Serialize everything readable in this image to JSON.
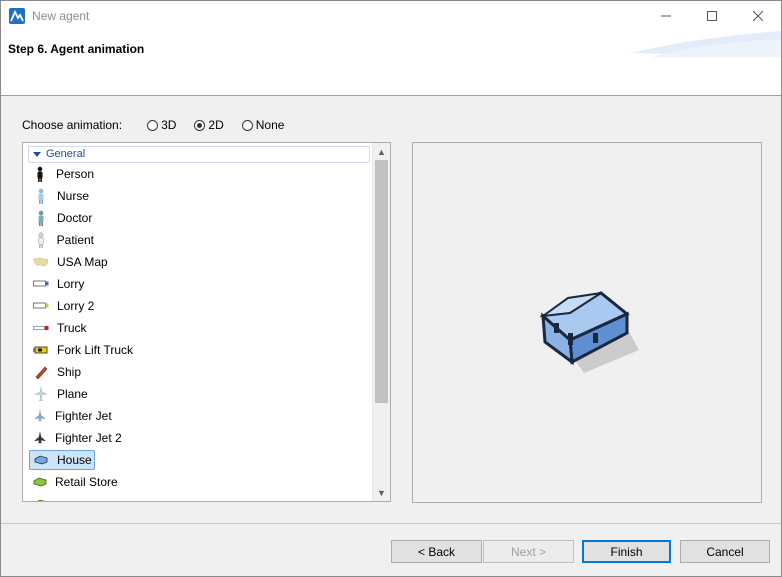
{
  "window": {
    "title": "New agent",
    "controls": {
      "minimize_icon": "minimize-icon",
      "maximize_icon": "maximize-icon",
      "close_icon": "close-icon"
    }
  },
  "header": {
    "title": "Step 6. Agent animation"
  },
  "animation_choice": {
    "label": "Choose animation:",
    "options": [
      {
        "label": "3D",
        "checked": false
      },
      {
        "label": "2D",
        "checked": true
      },
      {
        "label": "None",
        "checked": false
      }
    ]
  },
  "list": {
    "group": "General",
    "items": [
      {
        "label": "Person",
        "icon": "person-icon",
        "selected": false
      },
      {
        "label": "Nurse",
        "icon": "nurse-icon",
        "selected": false
      },
      {
        "label": "Doctor",
        "icon": "doctor-icon",
        "selected": false
      },
      {
        "label": "Patient",
        "icon": "patient-icon",
        "selected": false
      },
      {
        "label": "USA Map",
        "icon": "usa-map-icon",
        "selected": false
      },
      {
        "label": "Lorry",
        "icon": "lorry-icon",
        "selected": false
      },
      {
        "label": "Lorry 2",
        "icon": "lorry-2-icon",
        "selected": false
      },
      {
        "label": "Truck",
        "icon": "truck-icon",
        "selected": false
      },
      {
        "label": "Fork Lift Truck",
        "icon": "fork-lift-truck-icon",
        "selected": false
      },
      {
        "label": "Ship",
        "icon": "ship-icon",
        "selected": false
      },
      {
        "label": "Plane",
        "icon": "plane-icon",
        "selected": false
      },
      {
        "label": "Fighter Jet",
        "icon": "fighter-jet-icon",
        "selected": false
      },
      {
        "label": "Fighter Jet 2",
        "icon": "fighter-jet-2-icon",
        "selected": false
      },
      {
        "label": "House",
        "icon": "house-icon",
        "selected": true
      },
      {
        "label": "Retail Store",
        "icon": "retail-store-icon",
        "selected": false
      }
    ]
  },
  "preview": {
    "icon": "house-preview-icon"
  },
  "buttons": {
    "back": "< Back",
    "next": "Next >",
    "finish": "Finish",
    "cancel": "Cancel"
  },
  "colors": {
    "accent": "#0078d7",
    "selection": "#cce4f7",
    "group_text": "#1f4e9b",
    "house_blue": "#7aa7e0"
  }
}
